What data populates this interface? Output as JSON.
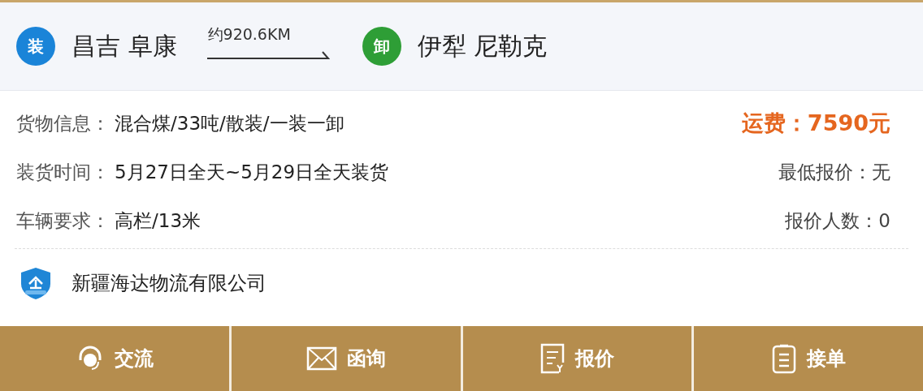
{
  "route": {
    "origin": {
      "badge": "装",
      "place": "昌吉 阜康"
    },
    "distance": "约920.6KM",
    "destination": {
      "badge": "卸",
      "place": "伊犁 尼勒克"
    }
  },
  "details": [
    {
      "label": "货物信息：",
      "value": "混合煤/33吨/散装/一装一卸"
    },
    {
      "label": "装货时间：",
      "value": "5月27日全天~5月29日全天装货"
    },
    {
      "label": "车辆要求：",
      "value": "高栏/13米"
    }
  ],
  "pricing": [
    {
      "kind": "fare",
      "text": "运费：",
      "value": "7590元"
    },
    {
      "kind": "plain",
      "text": "最低报价：",
      "value": "无"
    },
    {
      "kind": "plain",
      "text": "报价人数：",
      "value": "0"
    }
  ],
  "company": {
    "name": "新疆海达物流有限公司"
  },
  "actions": [
    {
      "kind": "chat",
      "label": "交流"
    },
    {
      "kind": "mail",
      "label": "函询"
    },
    {
      "kind": "quote",
      "label": "报价"
    },
    {
      "kind": "accept",
      "label": "接单"
    }
  ]
}
